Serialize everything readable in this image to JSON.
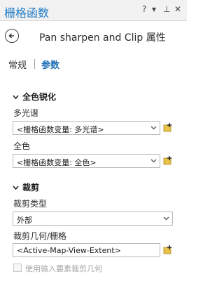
{
  "window": {
    "title": "栅格函数",
    "controls": {
      "help": "?",
      "menu": "▾",
      "pin": "⊥",
      "close": "✕"
    }
  },
  "header": {
    "title": "Pan sharpen and Clip 属性"
  },
  "tabs": [
    {
      "label": "常规"
    },
    {
      "label": "参数"
    }
  ],
  "sections": {
    "pansharpen": {
      "title": "全色锐化",
      "fields": [
        {
          "label": "多光谱",
          "value": "<栅格函数变量: 多光谱>"
        },
        {
          "label": "全色",
          "value": "<栅格函数变量: 全色>"
        }
      ]
    },
    "clip": {
      "title": "裁剪",
      "clip_type": {
        "label": "裁剪类型",
        "value": "外部"
      },
      "clip_geometry": {
        "label": "裁剪几何/栅格",
        "value": "<Active-Map-View-Extent>"
      },
      "checkbox": {
        "label": "使用输入要素裁剪几何",
        "checked": false
      }
    }
  },
  "icons": {
    "back": "arrow-left-circle",
    "add": "add-variable",
    "dropdown": "chevron-down",
    "section": "chevron-down"
  },
  "colors": {
    "accent": "#1f6fb5",
    "title": "#1f7bc7",
    "add_icon": "#d4a017"
  }
}
